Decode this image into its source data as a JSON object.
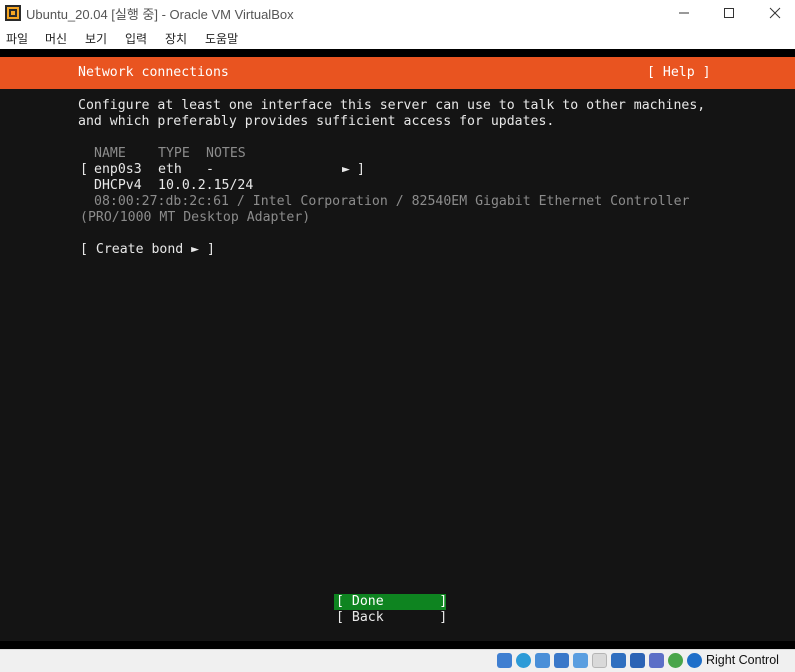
{
  "window": {
    "title": "Ubuntu_20.04 [실행 중] - Oracle VM VirtualBox",
    "app_icon": "virtualbox-icon"
  },
  "menubar": {
    "items": [
      "파일",
      "머신",
      "보기",
      "입력",
      "장치",
      "도움말"
    ]
  },
  "installer": {
    "header_title": "Network connections",
    "help_label": "[ Help ]",
    "description": [
      "Configure at least one interface this server can use to talk to other machines,",
      "and which preferably provides sufficient access for updates."
    ],
    "columns": [
      "NAME",
      "TYPE",
      "NOTES"
    ],
    "interface": {
      "bracket_open": "[",
      "name": "enp0s3",
      "type": "eth",
      "notes": "-",
      "arrow": "►",
      "bracket_close": "]",
      "dhcp_label": "DHCPv4",
      "address": "10.0.2.15/24",
      "detail_line1": "08:00:27:db:2c:61 / Intel Corporation / 82540EM Gigabit Ethernet Controller",
      "detail_line2": "(PRO/1000 MT Desktop Adapter)"
    },
    "create_bond_label": "[ Create bond ► ]",
    "done_label": "[ Done       ]",
    "back_label": "[ Back       ]"
  },
  "statusbar": {
    "icons": [
      "hard-disk-icon",
      "optical-drive-icon",
      "audio-icon",
      "network-icon",
      "usb-icon",
      "shared-folders-icon",
      "display-icon",
      "video-capture-icon",
      "virtualization-icon",
      "cpu-activity-icon",
      "mouse-integration-icon"
    ],
    "host_key_label": "Right Control"
  },
  "colors": {
    "accent_orange": "#e95420",
    "selected_green": "#0e8420",
    "console_bg": "#141414"
  }
}
